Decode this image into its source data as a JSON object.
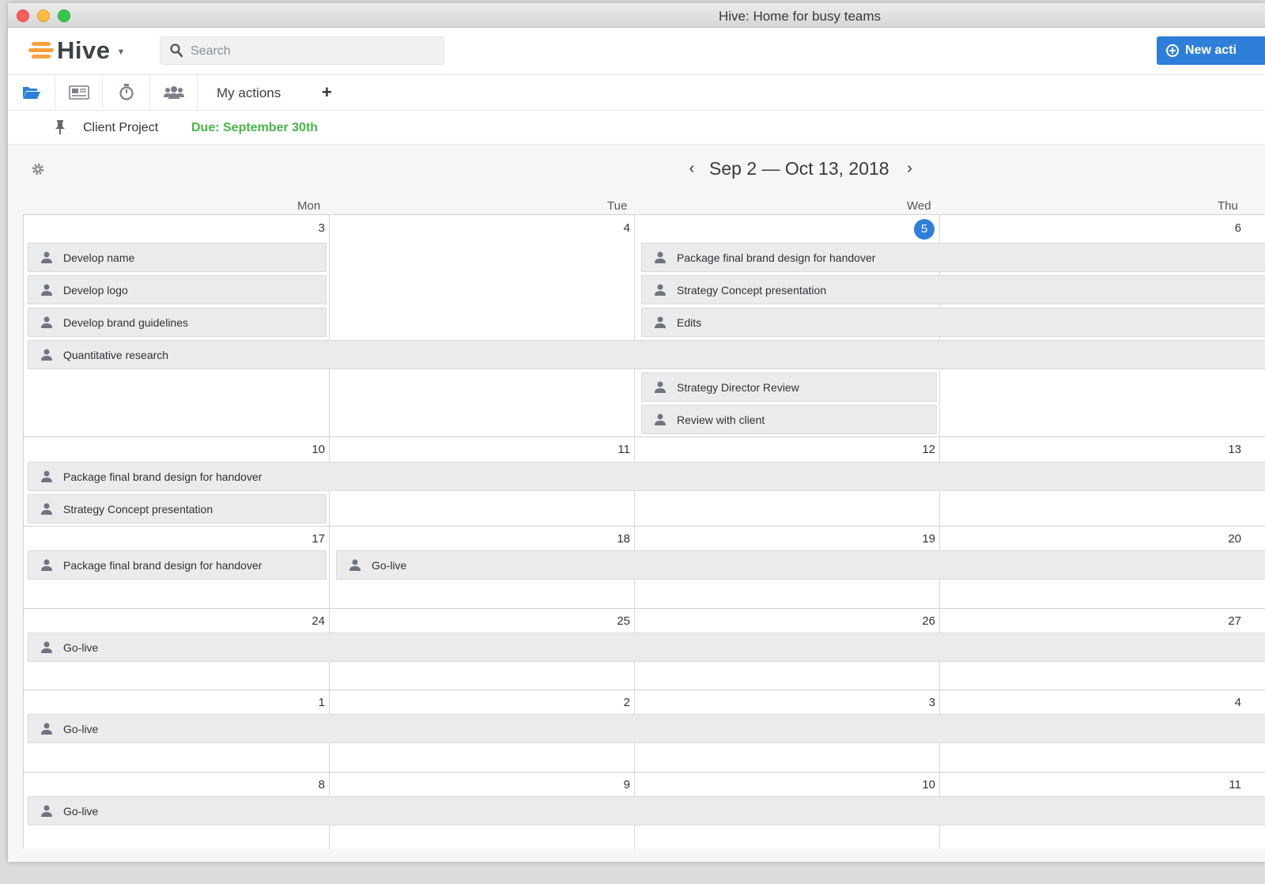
{
  "window": {
    "title": "Hive: Home for busy teams"
  },
  "header": {
    "logo_text": "Hive",
    "search_placeholder": "Search",
    "new_action_label": "New acti"
  },
  "toolbar": {
    "my_actions_label": "My actions",
    "add_label": "+"
  },
  "project": {
    "name": "Client Project",
    "due": "Due: September 30th"
  },
  "calendar": {
    "range": "Sep 2 — Oct 13, 2018",
    "day_headers": [
      "Mon",
      "Tue",
      "Wed",
      "Thu"
    ],
    "weeks": [
      [
        "3",
        "4",
        "5",
        "6"
      ],
      [
        "10",
        "11",
        "12",
        "13"
      ],
      [
        "17",
        "18",
        "19",
        "20"
      ],
      [
        "24",
        "25",
        "26",
        "27"
      ],
      [
        "1",
        "2",
        "3",
        "4"
      ],
      [
        "8",
        "9",
        "10",
        "11"
      ]
    ],
    "today": "5",
    "tasks": [
      "Develop name",
      "Develop logo",
      "Develop brand guidelines",
      "Quantitative research",
      "Package final brand design for handover",
      "Strategy Concept presentation",
      "Edits",
      "Strategy Director Review",
      "Review with client",
      "Package final brand design for handover",
      "Strategy Concept presentation",
      "Package final brand design for handover",
      "Go-live",
      "Go-live",
      "Go-live",
      "Go-live"
    ]
  },
  "colors": {
    "accent": "#2e7fd9",
    "due": "#49b549",
    "logo": "#f8a13d"
  }
}
